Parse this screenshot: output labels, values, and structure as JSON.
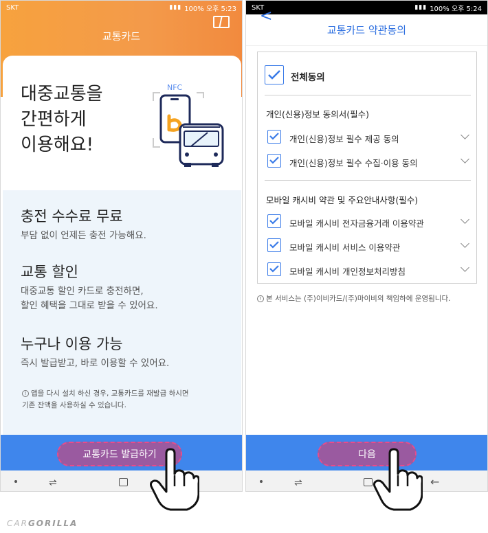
{
  "left": {
    "status": {
      "carrier": "SKT",
      "right": "100% 오후 5:23"
    },
    "header_title": "교통카드",
    "hero_title": "대중교통을\n간편하게\n이용해요!",
    "nfc_label": "NFC",
    "features": [
      {
        "title": "충전 수수료 무료",
        "desc": "부담 없이 언제든 충전 가능해요."
      },
      {
        "title": "교통 할인",
        "desc": "대중교통 할인 카드로 충전하면,\n할인 혜택을 그대로 받을 수 있어요."
      },
      {
        "title": "누구나 이용 가능",
        "desc": "즉시 발급받고, 바로 이용할 수 있어요."
      }
    ],
    "note": "앱을 다시 설치 하신 경우, 교통카드를 재발급 하시면\n기존 잔액을 사용하실 수 있습니다.",
    "cta_label": "교통카드 발급하기"
  },
  "right": {
    "status": {
      "carrier": "SKT",
      "right": "100% 오후 5:24"
    },
    "header_title": "교통카드 약관동의",
    "agree_all": "전체동의",
    "sections": [
      {
        "title": "개인(신용)정보 동의서(필수)",
        "items": [
          "개인(신용)정보 필수 제공 동의",
          "개인(신용)정보 필수 수집·이용 동의"
        ]
      },
      {
        "title": "모바일 캐시비 약관 및 주요안내사항(필수)",
        "items": [
          "모바일 캐시비 전자금융거래 이용약관",
          "모바일 캐시비 서비스 이용약관",
          "모바일 캐시비 개인정보처리방침"
        ]
      }
    ],
    "footnote": "본 서비스는 (주)이비카드/(주)마이비의 책임하에 운영됩니다.",
    "cta_label": "다음"
  },
  "watermark": {
    "prefix": "CAR",
    "suffix": "GORILLA"
  },
  "colors": {
    "orange": "#f7a23e",
    "blue": "#3f86ec",
    "purple": "#9a5aa0",
    "accent": "#2d6fe0"
  }
}
